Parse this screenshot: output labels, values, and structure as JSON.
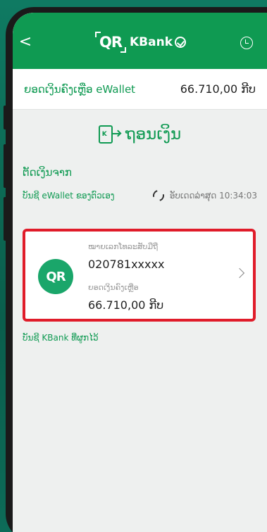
{
  "header": {
    "back_glyph": "<",
    "qr_logo": "QR",
    "brand": "KBank",
    "icons": {
      "back": "chevron-left-icon",
      "history": "history-icon",
      "emblem": "kbank-emblem-icon"
    }
  },
  "balance": {
    "label": "ຍອດເງິນຄົງເຫຼືອ eWallet",
    "amount": "66.710,00 ກີບ"
  },
  "page": {
    "title": "ຖອນເງິນ",
    "withdraw_icon_mark": "K",
    "section_label": "ຕັດເງິນຈາກ"
  },
  "account": {
    "type_label": "ບັນຊີ eWallet ຂອງຕົວເອງ",
    "last_update": "ອັບເດດລ່າສຸດ 10:34:03"
  },
  "card": {
    "logo": "QR",
    "phone_label": "ໝາຍເລກໂທລະສັບມືຖື",
    "phone_value": "020781xxxxx",
    "balance_label": "ຍອດເງິນຄົງເຫຼືອ",
    "balance_value": "66.710,00 ກີບ"
  },
  "link": {
    "kbank_account": "ບັນຊີ KBank ທີ່ຜູກໄວ້"
  },
  "colors": {
    "brand_green": "#0f9a52",
    "highlight_red": "#e01c2a"
  }
}
